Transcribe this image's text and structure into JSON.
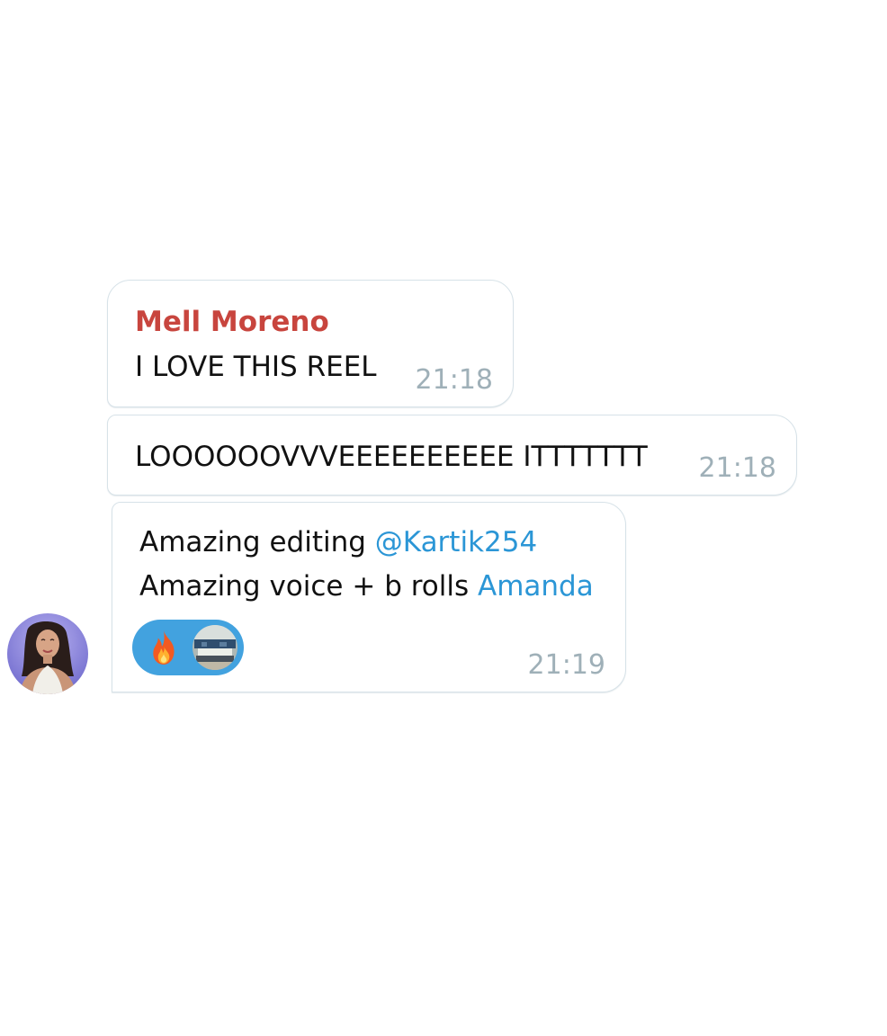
{
  "messages": [
    {
      "sender": "Mell Moreno",
      "text": "I LOVE THIS REEL",
      "time": "21:18"
    },
    {
      "text": "LOOOOOOVVVEEEEEEEEEE ITTTTTTT",
      "time": "21:18"
    },
    {
      "line1_text": "Amazing editing ",
      "line1_mention": "@Kartik254",
      "line2_text": "Amazing voice + b rolls ",
      "line2_mention": "Amanda",
      "time": "21:19",
      "reaction": {
        "emoji_icon": "fire-icon",
        "reactor_avatar": "reactor-avatar",
        "color": "#42a2df"
      }
    }
  ],
  "colors": {
    "sender_name": "#c8453e",
    "mention": "#2b96d6",
    "timestamp": "#9fb0b8",
    "reaction_bg": "#42a2df"
  }
}
